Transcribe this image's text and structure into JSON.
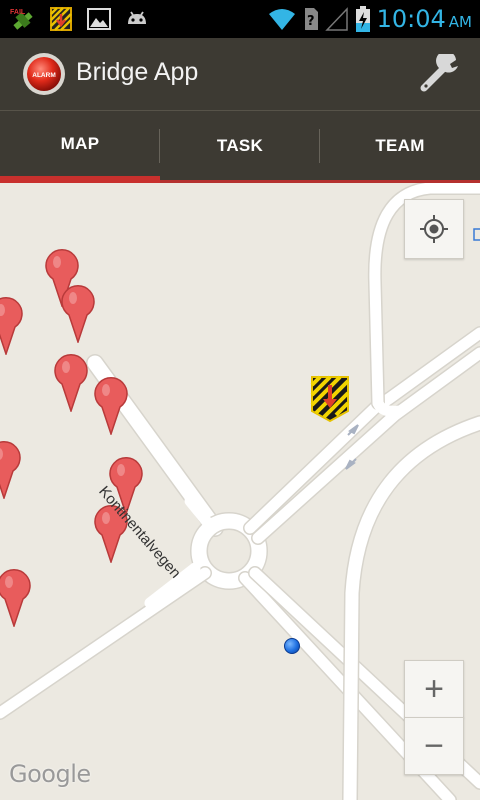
{
  "status_bar": {
    "time": "10:04",
    "ampm": "AM",
    "notification_icons": [
      "fail-satellite-icon",
      "hazard-notification-icon",
      "image-icon",
      "android-icon"
    ],
    "system_icons": [
      "wifi-icon",
      "no-sim-icon",
      "signal-icon",
      "battery-charging-icon"
    ],
    "fail_badge": "FAIL",
    "accent_color": "#33b5e5"
  },
  "action_bar": {
    "title": "Bridge App",
    "alarm_label": "ALARM",
    "settings_icon": "wrench-icon"
  },
  "tabs": [
    {
      "label": "MAP",
      "active": true
    },
    {
      "label": "TASK",
      "active": false
    },
    {
      "label": "TEAM",
      "active": false
    }
  ],
  "map": {
    "road_label": "Kontinentalvegen",
    "attribution": "Google",
    "zoom_in": "+",
    "zoom_out": "−",
    "pin_color": "#e84c4c",
    "tab_accent": "#c8302d"
  }
}
